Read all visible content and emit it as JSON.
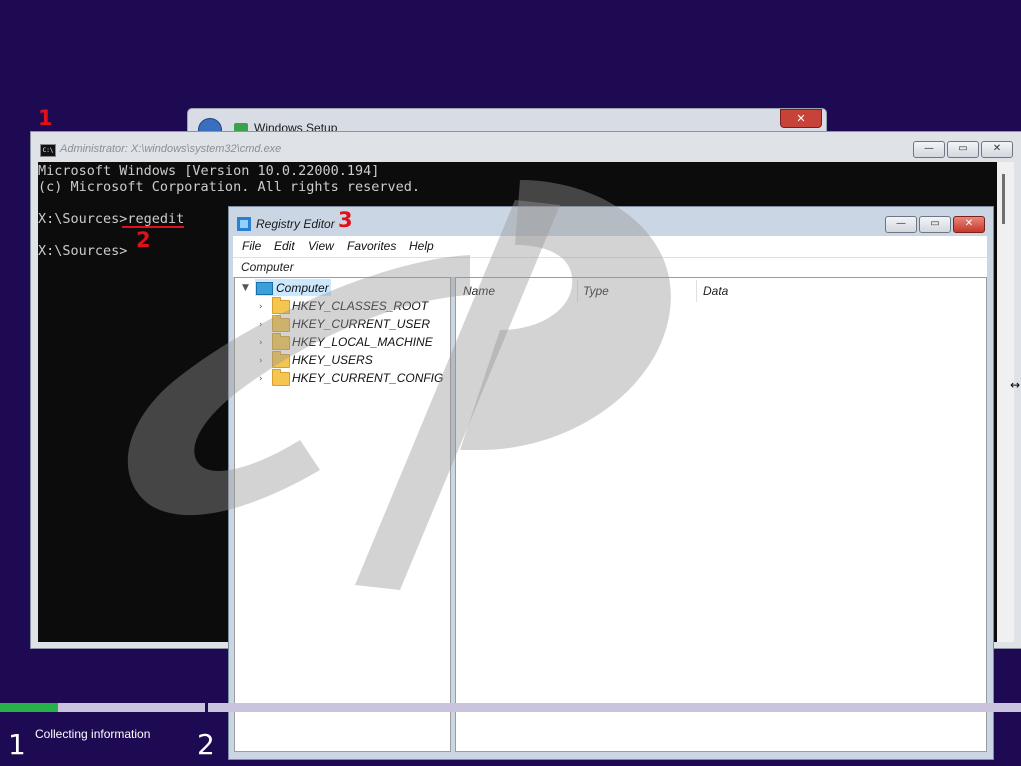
{
  "steps": {
    "one": "1",
    "two": "2",
    "three": "3"
  },
  "setup": {
    "title": "Windows Setup",
    "close": "✕"
  },
  "cmd": {
    "title": "Administrator: X:\\windows\\system32\\cmd.exe",
    "icon_text": "C:\\",
    "lines": [
      "Microsoft Windows [Version 10.0.22000.194]",
      "(c) Microsoft Corporation. All rights reserved.",
      "",
      "X:\\Sources>regedit",
      "",
      "X:\\Sources>"
    ],
    "btn_min": "—",
    "btn_max": "▭",
    "btn_close": "✕"
  },
  "regedit": {
    "title": "Registry Editor",
    "menu": [
      "File",
      "Edit",
      "View",
      "Favorites",
      "Help"
    ],
    "address": "Computer",
    "tree_root": "Computer",
    "tree_items": [
      "HKEY_CLASSES_ROOT",
      "HKEY_CURRENT_USER",
      "HKEY_LOCAL_MACHINE",
      "HKEY_USERS",
      "HKEY_CURRENT_CONFIG"
    ],
    "columns": [
      "Name",
      "Type",
      "Data"
    ],
    "btn_min": "—",
    "btn_max": "▭",
    "btn_close": "✕"
  },
  "status": {
    "step1_num": "1",
    "step1_label": "Collecting information",
    "step2_num": "2",
    "progress_fraction": 0.057
  },
  "colors": {
    "desktop": "#1e0a52",
    "progress": "#27b14a",
    "annotation": "#e0101a"
  },
  "icons": [
    "command-prompt-icon",
    "registry-editor-icon",
    "folder-icon",
    "computer-icon",
    "chevron-right-icon",
    "chevron-down-icon",
    "close-icon",
    "minimize-icon",
    "maximize-icon",
    "back-arrow-icon"
  ]
}
